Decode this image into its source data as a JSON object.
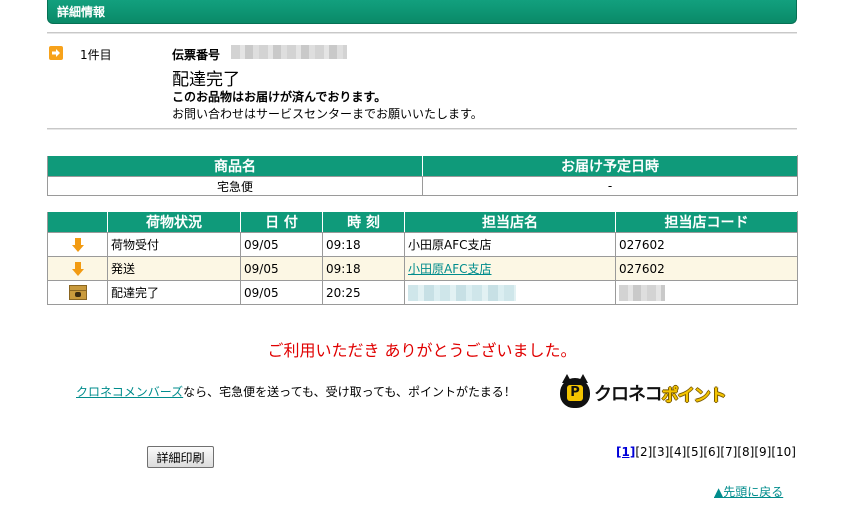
{
  "section": {
    "title": "詳細情報"
  },
  "record": {
    "count_label": "1件目",
    "slip_label": "伝票番号",
    "status_title": "配達完了",
    "status_message": "このお品物はお届けが済んでおります。",
    "contact_note": "お問い合わせはサービスセンターまでお願いいたします。"
  },
  "product_table": {
    "headers": [
      "商品名",
      "お届け予定日時"
    ],
    "row": [
      "宅急便",
      "-"
    ]
  },
  "tracking_table": {
    "headers": [
      "荷物状況",
      "日 付",
      "時 刻",
      "担当店名",
      "担当店コード"
    ],
    "rows": [
      {
        "icon": "down-arrow-icon",
        "status": "荷物受付",
        "date": "09/05",
        "time": "09:18",
        "store": "小田原AFC支店",
        "code": "027602"
      },
      {
        "icon": "down-arrow-icon",
        "status": "発送",
        "date": "09/05",
        "time": "09:18",
        "store": "小田原AFC支店",
        "code": "027602"
      },
      {
        "icon": "package-icon",
        "status": "配達完了",
        "date": "09/05",
        "time": "20:25",
        "store": "",
        "code": ""
      }
    ]
  },
  "thanks": "ご利用いただき ありがとうございました。",
  "promo": {
    "link_text": "クロネコメンバーズ",
    "text": "なら、宅急便を送っても、受け取っても、ポイントがたまる！",
    "logo_badge": "P",
    "logo_word1": "クロネコ",
    "logo_word2": "ポイント"
  },
  "print_button": "詳細印刷",
  "pager": {
    "current": "[1]",
    "pages": [
      "[2]",
      "[3]",
      "[4]",
      "[5]",
      "[6]",
      "[7]",
      "[8]",
      "[9]",
      "[10]"
    ]
  },
  "back_to_top": "▲先頭に戻る",
  "colors": {
    "header_green": "#0f9a7a",
    "accent_orange": "#f29b12",
    "thanks_red": "#e00000",
    "alt_row": "#fcf7e4"
  }
}
